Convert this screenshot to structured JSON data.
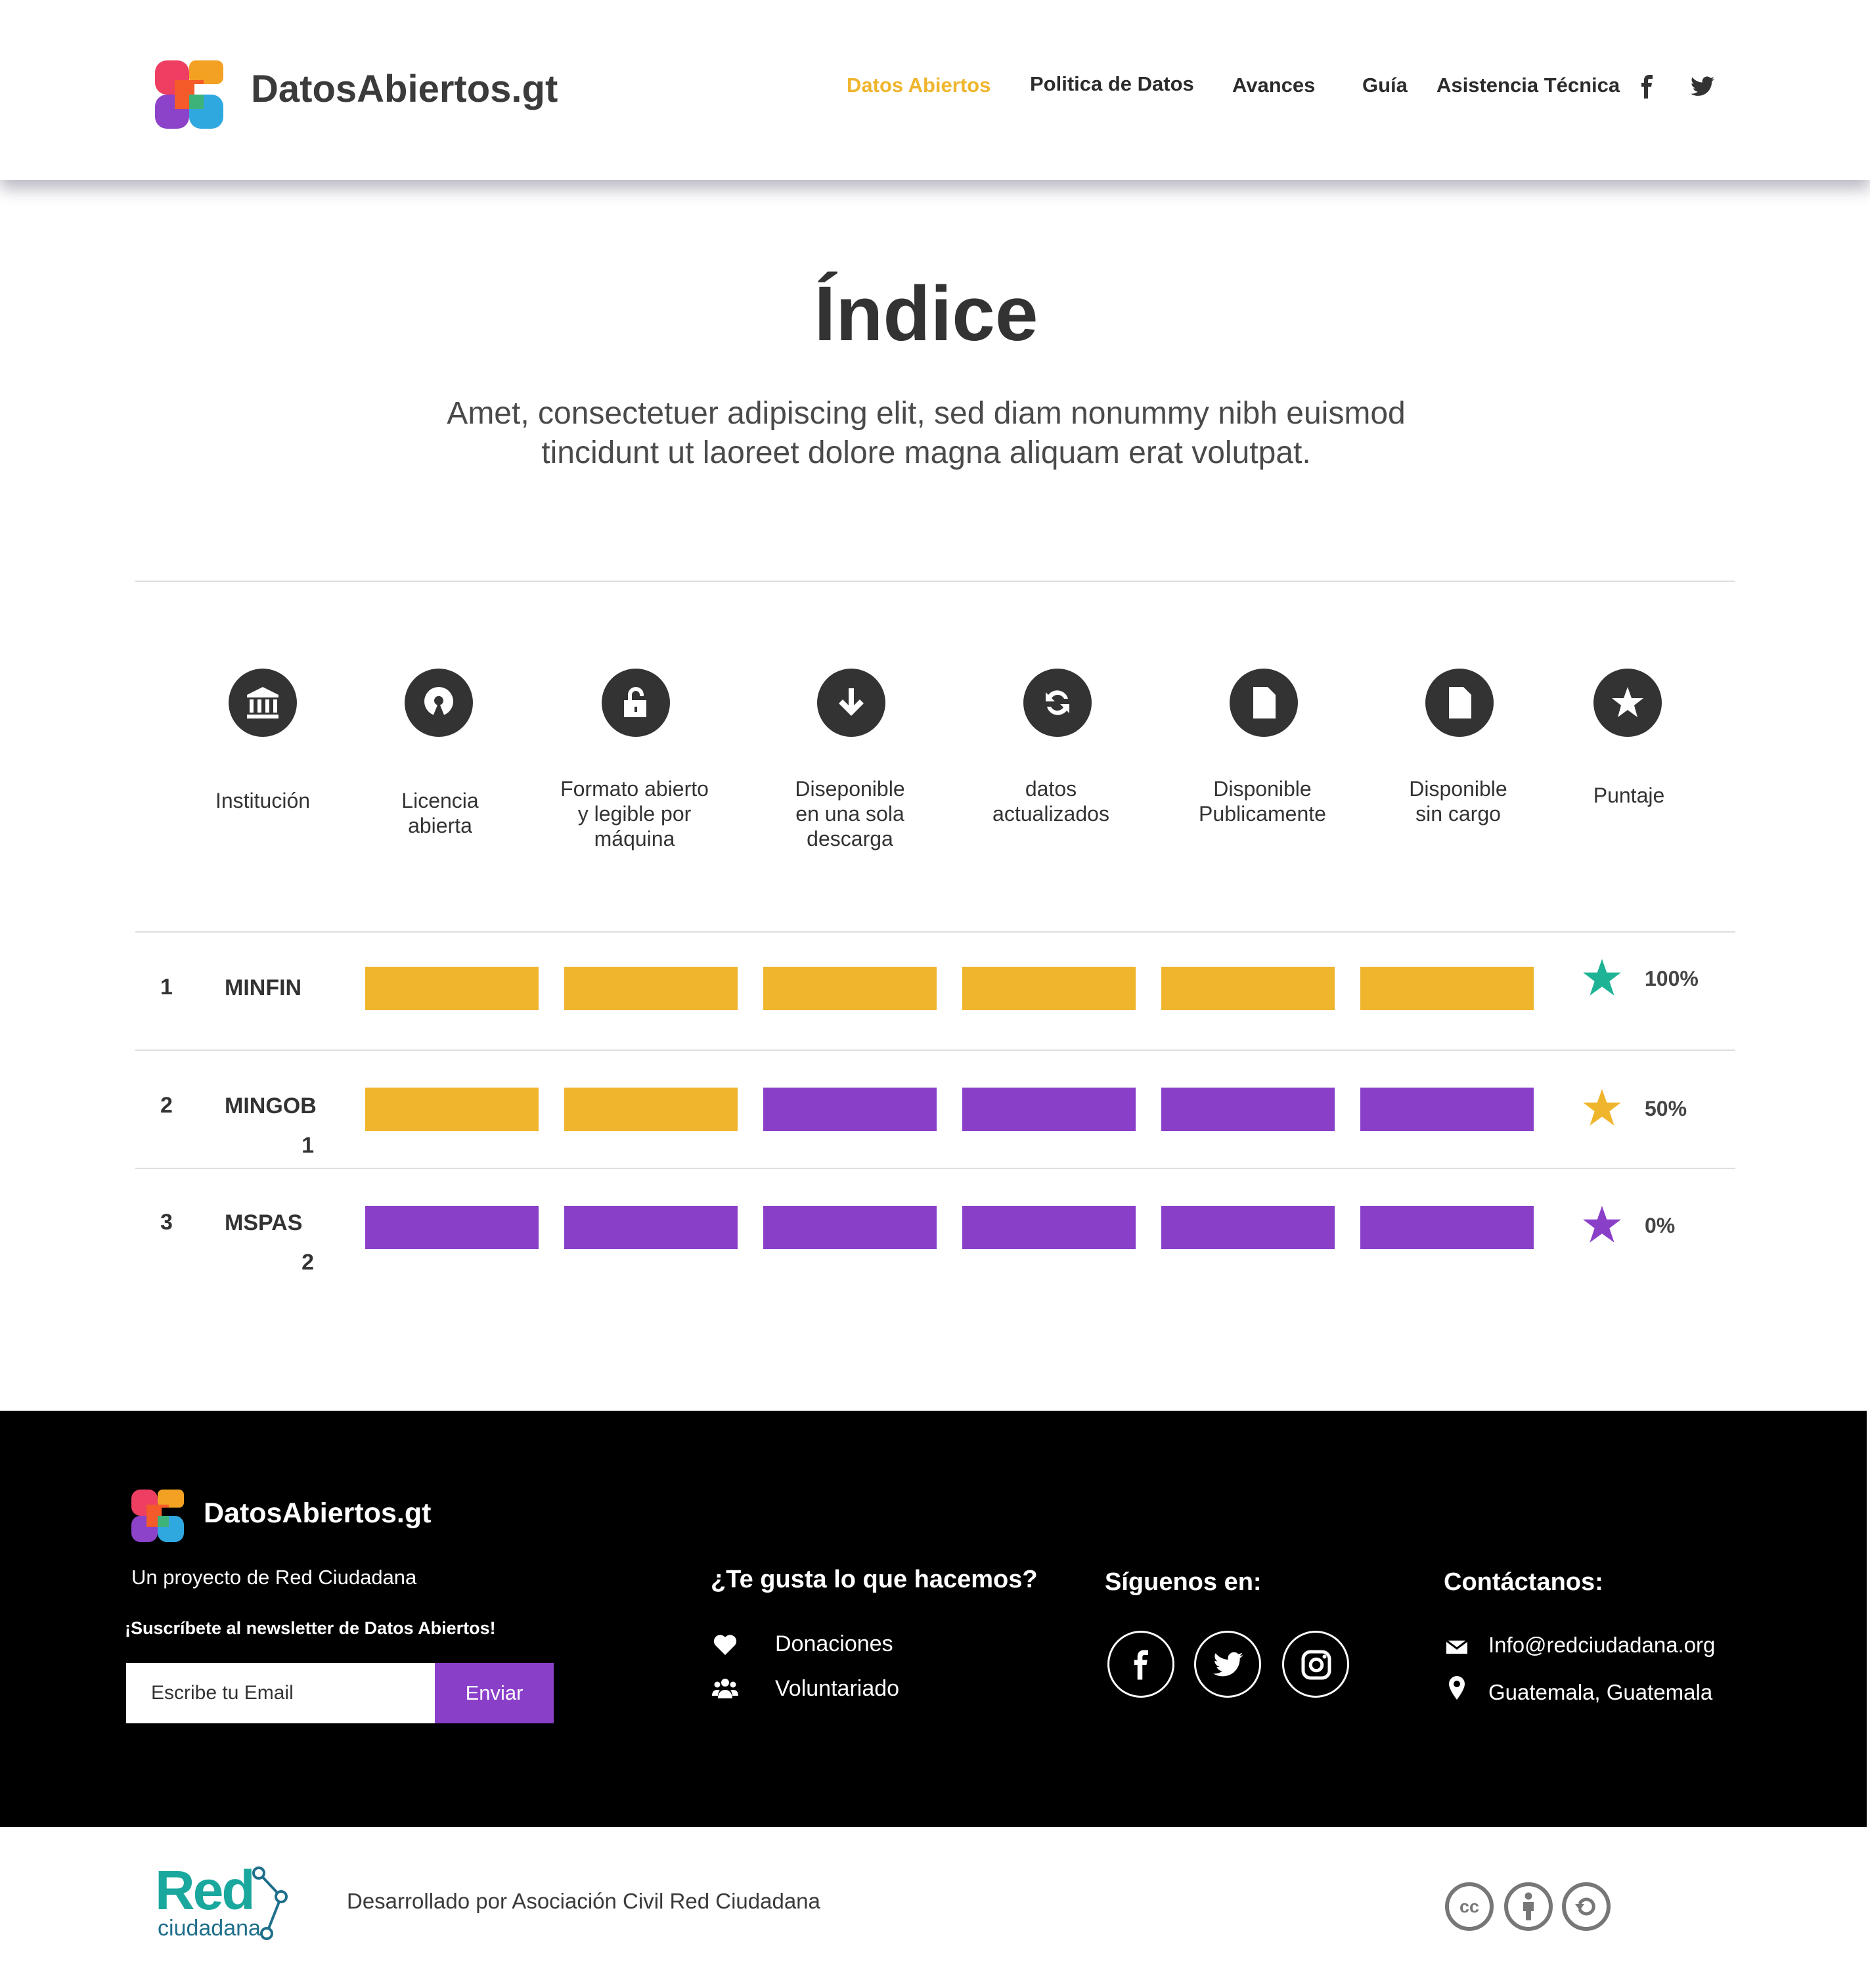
{
  "brand": {
    "name": "DatosAbiertos.gt"
  },
  "nav": {
    "items": [
      "Datos Abiertos",
      "Politica de Datos",
      "Avances",
      "Guía",
      "Asistencia Técnica"
    ],
    "active": "Datos Abiertos",
    "social": [
      "facebook-icon",
      "twitter-icon"
    ]
  },
  "hero": {
    "title": "Índice",
    "subtitle_line1": "Amet, consectetuer adipiscing elit, sed diam nonummy nibh euismod",
    "subtitle_line2": "tincidunt ut laoreet dolore magna aliquam erat volutpat."
  },
  "criteria": [
    {
      "icon": "institution-icon",
      "label": [
        "Institución"
      ]
    },
    {
      "icon": "open-source-icon",
      "label": [
        "Licencia",
        "abierta"
      ]
    },
    {
      "icon": "unlock-icon",
      "label": [
        "Formato abierto",
        "y legible por",
        "máquina"
      ]
    },
    {
      "icon": "download-icon",
      "label": [
        "Diseponible",
        "en una sola",
        "descarga"
      ]
    },
    {
      "icon": "refresh-icon",
      "label": [
        "datos",
        "actualizados"
      ]
    },
    {
      "icon": "document-icon",
      "label": [
        "Disponible",
        "Publicamente"
      ]
    },
    {
      "icon": "document-icon",
      "label": [
        "Disponible",
        "sin cargo"
      ]
    },
    {
      "icon": "star-icon",
      "label": [
        "Puntaje"
      ]
    }
  ],
  "rows": [
    {
      "rank": "1",
      "institution": [
        "MINFIN"
      ],
      "bars": [
        "yes",
        "yes",
        "yes",
        "yes",
        "yes",
        "yes"
      ],
      "score": "100%",
      "star_color": "#1fb395"
    },
    {
      "rank": "2",
      "institution": [
        "MINGOB",
        "1"
      ],
      "bars": [
        "yes",
        "yes",
        "no",
        "no",
        "no",
        "no"
      ],
      "score": "50%",
      "star_color": "#efb52d"
    },
    {
      "rank": "3",
      "institution": [
        "MSPAS",
        "2"
      ],
      "bars": [
        "no",
        "no",
        "no",
        "no",
        "no",
        "no"
      ],
      "score": "0%",
      "star_color": "#8a3fc9"
    }
  ],
  "colors": {
    "yes": "#efb52d",
    "no": "#8a3fc9",
    "accent": "#efb52d"
  },
  "footer": {
    "tagline": "Un proyecto de Red Ciudadana",
    "newsletter": "¡Suscríbete al newsletter de Datos Abiertos!",
    "email_placeholder": "Escribe tu Email",
    "send": "Enviar",
    "like_title": "¿Te gusta lo que hacemos?",
    "donate": "Donaciones",
    "volunteer": "Voluntariado",
    "follow_title": "Síguenos en:",
    "follow": [
      "facebook-icon",
      "twitter-icon",
      "instagram-icon"
    ],
    "contact_title": "Contáctanos:",
    "contact_email": "Info@redciudadana.org",
    "contact_place": "Guatemala, Guatemala"
  },
  "bottom": {
    "org_logo_main": "Red",
    "org_logo_sub": "ciudadana",
    "credit": "Desarrollado por Asociación Civil Red Ciudadana",
    "license_icons": [
      "cc-icon",
      "by-icon",
      "sa-icon"
    ]
  }
}
